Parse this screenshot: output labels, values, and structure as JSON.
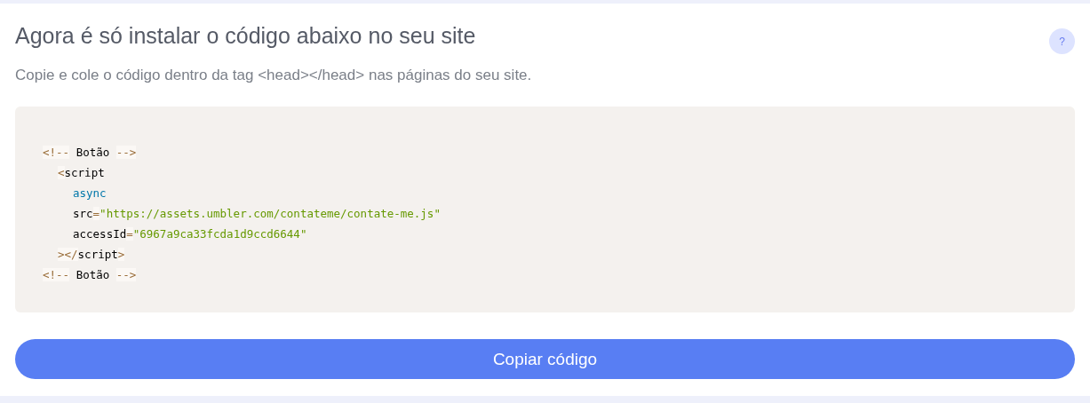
{
  "title": "Agora é só instalar o código abaixo no seu site",
  "help_button": {
    "label": "?"
  },
  "subtitle": "Copie e cole o código dentro da tag <head></head> nas páginas do seu site.",
  "code": [
    {
      "tokens": [
        {
          "kind": "punct",
          "text": "<!--"
        },
        {
          "kind": "text",
          "text": " Botão "
        },
        {
          "kind": "punct",
          "text": "-->"
        }
      ],
      "children": [
        {
          "tokens": [
            {
              "kind": "punct",
              "text": "<"
            },
            {
              "kind": "text",
              "text": "script"
            }
          ],
          "children": [
            {
              "tokens": [
                {
                  "kind": "keyword",
                  "text": "async"
                }
              ]
            },
            {
              "tokens": [
                {
                  "kind": "text",
                  "text": "src"
                },
                {
                  "kind": "punct",
                  "text": "="
                },
                {
                  "kind": "string",
                  "text": "\"https://assets.umbler.com/contateme/contate-me.js\""
                }
              ]
            },
            {
              "tokens": [
                {
                  "kind": "text",
                  "text": "accessId"
                },
                {
                  "kind": "punct",
                  "text": "="
                },
                {
                  "kind": "string",
                  "text": "\"6967a9ca33fcda1d9ccd6644\""
                }
              ]
            }
          ]
        },
        {
          "tokens": [
            {
              "kind": "punct",
              "text": "></"
            },
            {
              "kind": "text",
              "text": "script"
            },
            {
              "kind": "punct",
              "text": ">"
            }
          ]
        }
      ]
    },
    {
      "tokens": [
        {
          "kind": "punct",
          "text": "<!--"
        },
        {
          "kind": "text",
          "text": " Botão "
        },
        {
          "kind": "punct",
          "text": "-->"
        }
      ]
    }
  ],
  "copy_button": {
    "label": "Copiar código"
  }
}
